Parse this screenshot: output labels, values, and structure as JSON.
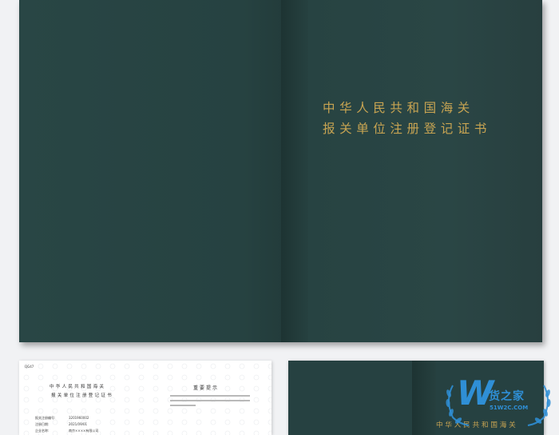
{
  "cover": {
    "title_line1": "中华人民共和国海关",
    "title_line2": "报关单位注册登记证书"
  },
  "document_page": {
    "code": "QG47",
    "title_line1": "中华人民共和国海关",
    "title_line2": "报关单位注册登记证书",
    "notice_title": "重要提示",
    "fields": [
      {
        "label": "报关注册编号:",
        "value": "3201960002"
      },
      {
        "label": "注册日期:",
        "value": "2021/09/01"
      },
      {
        "label": "企业名称:",
        "value": "南京××××有限公司"
      }
    ]
  },
  "watermark": {
    "logo_letter": "W",
    "brand_text": "货之家",
    "url_text": "51W2C.COM",
    "color": "#2f8fd6"
  },
  "colors": {
    "cover_green": "#264141",
    "gold": "#c8a452"
  }
}
